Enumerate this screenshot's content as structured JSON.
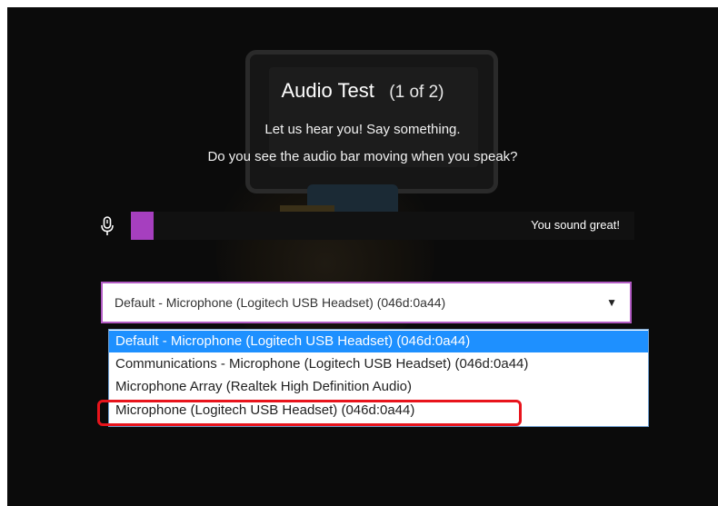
{
  "dialog": {
    "title": "Audio Test",
    "step_count": "(1 of 2)",
    "prompt_line1": "Let us hear you! Say something.",
    "prompt_line2": "Do you see the audio bar moving when you speak?"
  },
  "audio_meter": {
    "level_fraction": 0.045,
    "status_text": "You sound great!",
    "fill_color": "#a63fbf",
    "icon": "microphone-icon"
  },
  "microphone_select": {
    "selected_value": "Default - Microphone (Logitech USB Headset) (046d:0a44)",
    "arrow_glyph": "▼",
    "options": [
      "Default - Microphone (Logitech USB Headset) (046d:0a44)",
      "Communications - Microphone (Logitech USB Headset) (046d:0a44)",
      "Microphone Array (Realtek High Definition Audio)",
      "Microphone (Logitech USB Headset) (046d:0a44)"
    ],
    "highlighted_option_index": 0,
    "annotated_option_index": 3
  },
  "colors": {
    "background": "#0b0b0b",
    "selected_option": "#1e90ff",
    "annotation_outline": "#e8141c",
    "select_border": "#b25bc4"
  }
}
